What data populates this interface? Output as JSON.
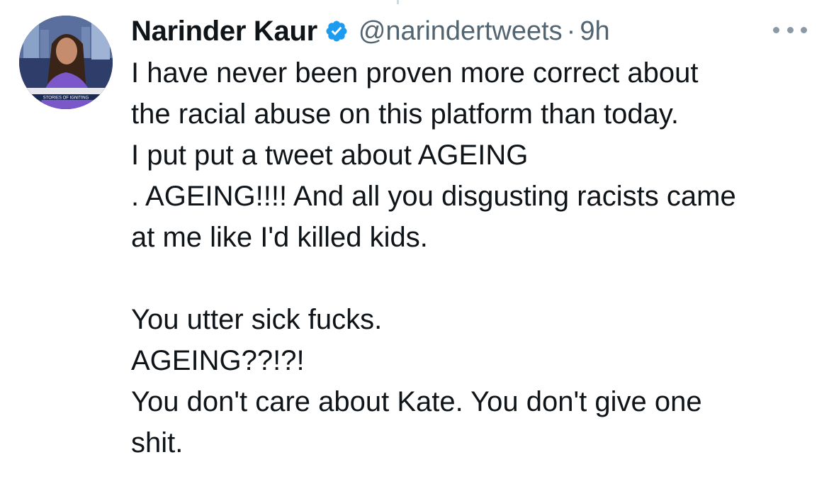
{
  "tweet": {
    "author": {
      "display_name": "Narinder Kaur",
      "handle": "@narindertweets",
      "verified": true,
      "avatar_caption": "STORIES OF IGNITING"
    },
    "separator": "·",
    "time": "9h",
    "more_icon": "more-horizontal-icon",
    "text_lines": [
      "I have never been proven more correct about",
      "the racial abuse on this platform than today.",
      "I put put a tweet about AGEING",
      ". AGEING!!!! And all you disgusting racists came",
      "at me like I'd killed kids.",
      "",
      "You utter sick fucks.",
      "AGEING??!?!",
      "You don't care about Kate. You don't give one",
      "shit."
    ]
  },
  "colors": {
    "text": "#0f1419",
    "secondary": "#536471",
    "verified_badge": "#1d9bf0",
    "thread_line": "#cfd9de"
  }
}
